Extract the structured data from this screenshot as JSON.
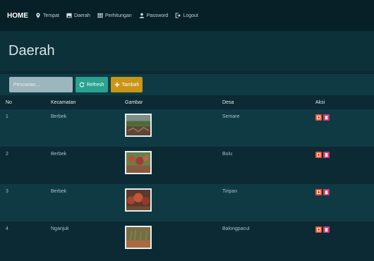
{
  "nav": {
    "brand": "HOME",
    "items": [
      {
        "label": "Tempat",
        "icon": "map-marker-icon"
      },
      {
        "label": "Daerah",
        "icon": "image-icon"
      },
      {
        "label": "Perhitungan",
        "icon": "table-icon"
      },
      {
        "label": "Password",
        "icon": "user-icon"
      },
      {
        "label": "Logout",
        "icon": "logout-icon"
      }
    ]
  },
  "page": {
    "title": "Daerah"
  },
  "toolbar": {
    "search_placeholder": "Pencarian...",
    "refresh_label": "Refresh",
    "add_label": "Tambah"
  },
  "table": {
    "columns": [
      "No",
      "Kecamatan",
      "Gambar",
      "Desa",
      "Aksi"
    ],
    "rows": [
      {
        "no": "1",
        "kecamatan": "Berbek",
        "desa": "Semare"
      },
      {
        "no": "2",
        "kecamatan": "Berbek",
        "desa": "Bulu"
      },
      {
        "no": "3",
        "kecamatan": "Berbek",
        "desa": "Tiripan"
      },
      {
        "no": "4",
        "kecamatan": "Nganjuk",
        "desa": "Balongpacul"
      }
    ]
  },
  "colors": {
    "navbar": "#071f27",
    "background": "#0b2a33",
    "refresh": "#2aa28f",
    "add": "#c99616",
    "edit": "#e8542c",
    "delete": "#d8336f"
  }
}
